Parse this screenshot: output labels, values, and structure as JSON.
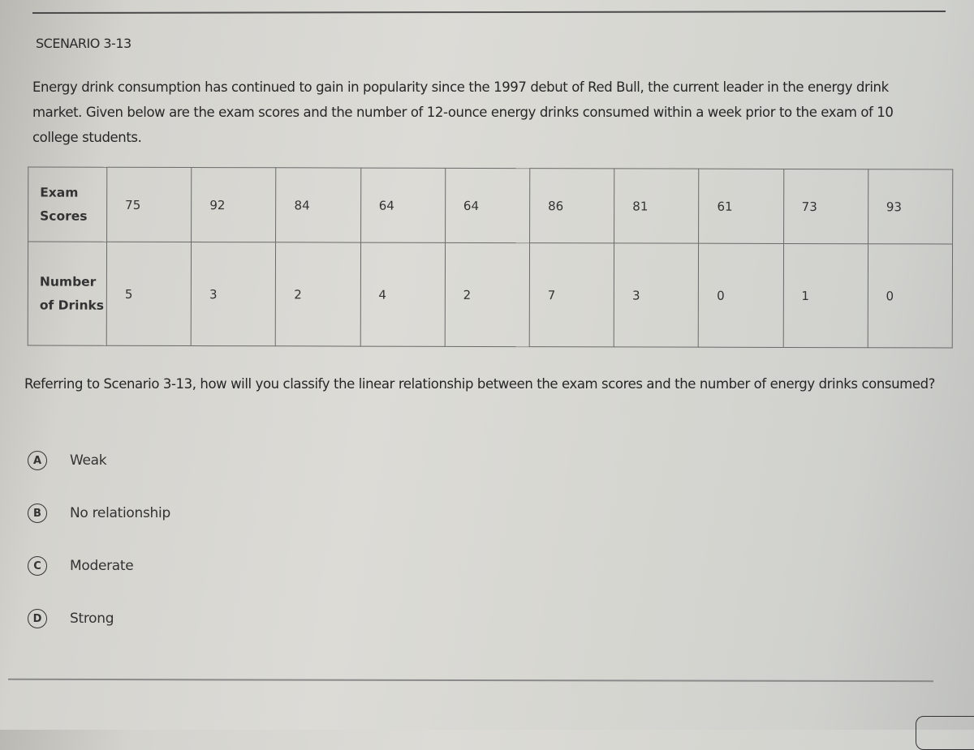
{
  "scenario": {
    "title": "SCENARIO 3-13",
    "text": "Energy drink consumption has continued to gain in popularity since the 1997 debut of Red Bull, the current leader in the energy drink market. Given below are the exam scores and the number of 12-ounce energy drinks consumed within a week prior to the exam of 10 college students."
  },
  "table": {
    "rows": [
      {
        "header": "Exam Scores",
        "values": [
          "75",
          "92",
          "84",
          "64",
          "64",
          "86",
          "81",
          "61",
          "73",
          "93"
        ]
      },
      {
        "header": "Number of Drinks",
        "values": [
          "5",
          "3",
          "2",
          "4",
          "2",
          "7",
          "3",
          "0",
          "1",
          "0"
        ]
      }
    ]
  },
  "question": {
    "text": "Referring to Scenario 3-13, how will you classify the linear relationship between the exam scores and the number of energy drinks consumed?"
  },
  "options": [
    {
      "letter": "A",
      "label": "Weak"
    },
    {
      "letter": "B",
      "label": "No relationship"
    },
    {
      "letter": "C",
      "label": "Moderate"
    },
    {
      "letter": "D",
      "label": "Strong"
    }
  ]
}
